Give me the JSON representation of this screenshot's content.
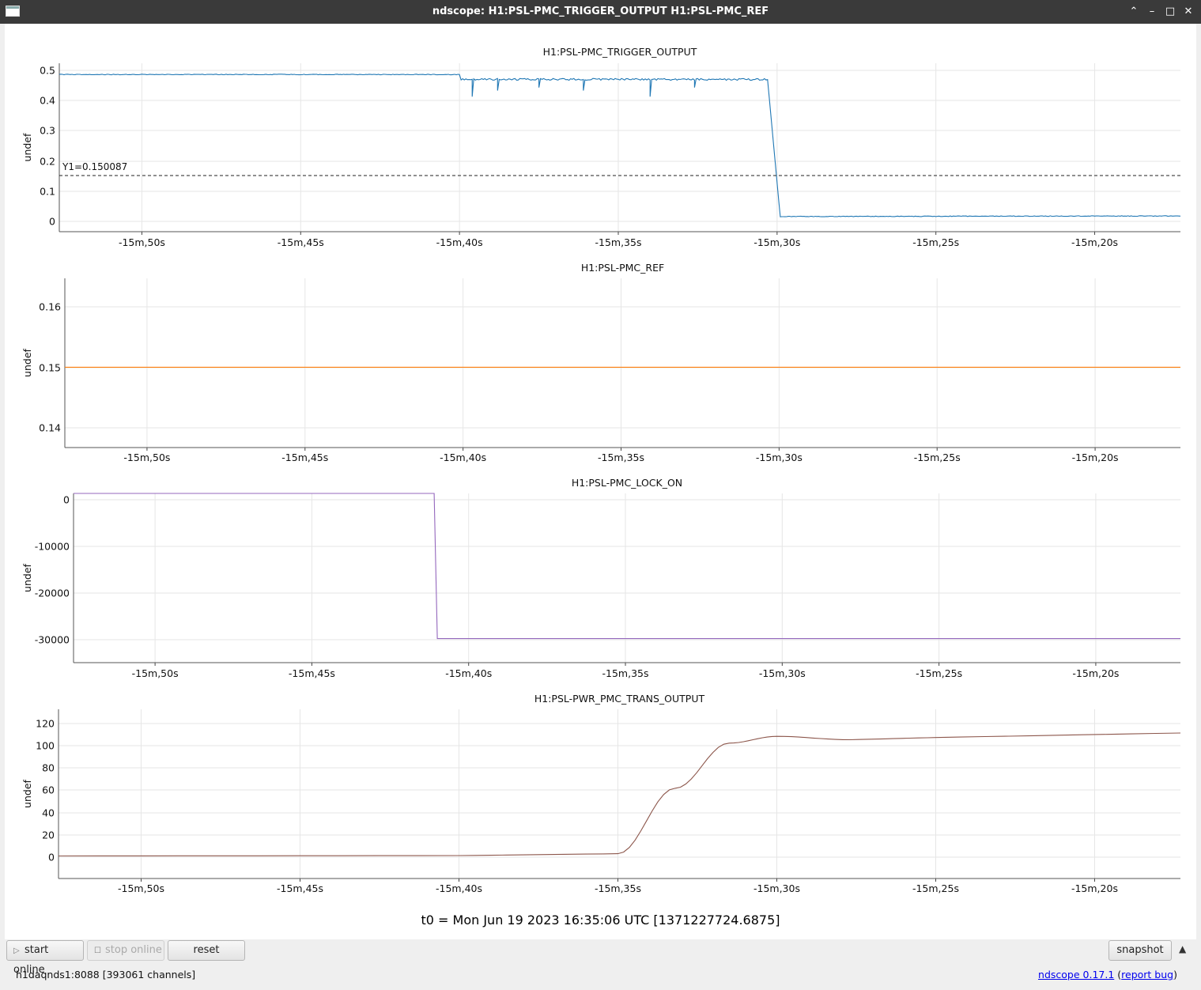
{
  "window": {
    "title": "ndscope: H1:PSL-PMC_TRIGGER_OUTPUT H1:PSL-PMC_REF",
    "buttons": [
      "⌃",
      "–",
      "□",
      "✕"
    ]
  },
  "x_tick_labels": [
    "-15m,50s",
    "-15m,45s",
    "-15m,40s",
    "-15m,35s",
    "-15m,30s",
    "-15m,25s",
    "-15m,20s"
  ],
  "plots": [
    {
      "title": "H1:PSL-PMC_TRIGGER_OUTPUT",
      "ylabel": "undef",
      "yticks": [
        "0.5",
        "0.4",
        "0.3",
        "0.2",
        "0.1",
        "0"
      ],
      "cursor_label": "Y1=0.150087",
      "color": "#1f77b4"
    },
    {
      "title": "H1:PSL-PMC_REF",
      "ylabel": "undef",
      "yticks": [
        "0.16",
        "0.15",
        "0.14"
      ],
      "color": "#ff7f0e"
    },
    {
      "title": "H1:PSL-PMC_LOCK_ON",
      "ylabel": "undef",
      "yticks": [
        "0",
        "-10000",
        "-20000",
        "-30000"
      ],
      "color": "#9467bd"
    },
    {
      "title": "H1:PSL-PWR_PMC_TRANS_OUTPUT",
      "ylabel": "undef",
      "yticks": [
        "120",
        "100",
        "80",
        "60",
        "40",
        "20",
        "0"
      ],
      "color": "#8c564b"
    }
  ],
  "chart_data": [
    {
      "type": "line",
      "title": "H1:PSL-PMC_TRIGGER_OUTPUT",
      "ylabel": "undef",
      "x_unit": "seconds relative to t0",
      "x": [
        -952.6,
        -940,
        -935,
        -930.5,
        -929,
        -925,
        -920
      ],
      "series": [
        {
          "values": [
            0.483,
            0.482,
            0.47,
            0.466,
            0.013,
            0.016,
            0.018
          ]
        }
      ],
      "ylim": [
        -0.035,
        0.52
      ],
      "cursor_y": 0.150087,
      "grid": true
    },
    {
      "type": "line",
      "title": "H1:PSL-PMC_REF",
      "ylabel": "undef",
      "x": [
        -952.6,
        -917.3
      ],
      "series": [
        {
          "values": [
            0.15,
            0.15
          ]
        }
      ],
      "ylim": [
        0.1367,
        0.1647
      ],
      "grid": true
    },
    {
      "type": "line",
      "title": "H1:PSL-PMC_LOCK_ON",
      "ylabel": "undef",
      "x": [
        -952.6,
        -941.1,
        -941.0,
        -917.3
      ],
      "series": [
        {
          "values": [
            0,
            0,
            -29950,
            -29950
          ]
        }
      ],
      "ylim": [
        -34900,
        0
      ],
      "grid": true
    },
    {
      "type": "line",
      "title": "H1:PSL-PWR_PMC_TRANS_OUTPUT",
      "ylabel": "undef",
      "x": [
        -952.6,
        -940,
        -935,
        -933.2,
        -931.5,
        -930,
        -927.7,
        -925,
        -917.3
      ],
      "series": [
        {
          "values": [
            0,
            0.3,
            2.0,
            60,
            100,
            106,
            103,
            105,
            109
          ]
        }
      ],
      "ylim": [
        -20,
        130
      ],
      "grid": true
    }
  ],
  "t0_label": "t0 = Mon Jun 19 2023 16:35:06 UTC [1371227724.6875]",
  "toolbar": {
    "start_online": "start online",
    "stop_online": "stop online",
    "reset": "reset",
    "snapshot": "snapshot"
  },
  "status": {
    "server": "h1daqnds1:8088  [393061 channels]",
    "version_link": "ndscope 0.17.1",
    "report_open": "(",
    "report_link": "report bug",
    "report_close": ")"
  }
}
